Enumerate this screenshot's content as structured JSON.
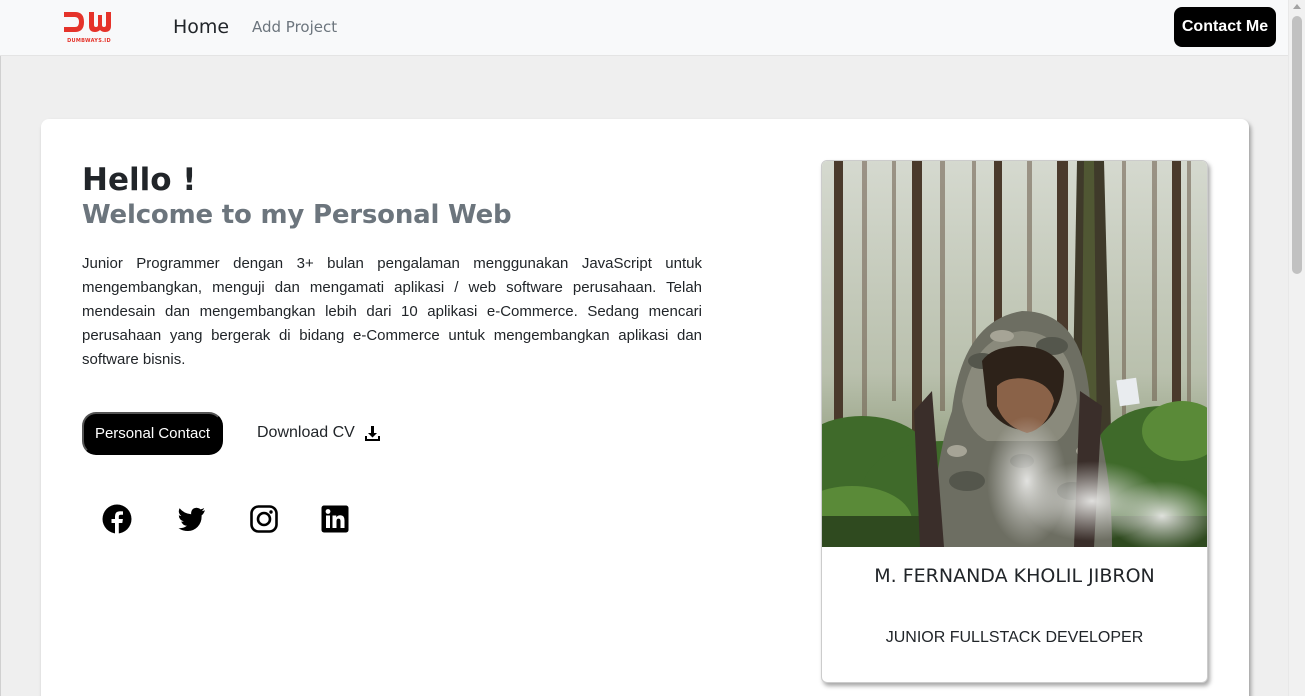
{
  "navbar": {
    "logo_text": "DUMBWAYS.ID",
    "home_label": "Home",
    "add_project_label": "Add Project",
    "contact_label": "Contact Me"
  },
  "hero": {
    "hello": "Hello !",
    "welcome": "Welcome to my Personal Web",
    "description": "Junior Programmer dengan 3+ bulan pengalaman menggunakan JavaScript untuk mengembangkan, menguji dan mengamati aplikasi / web software perusahaan. Telah mendesain dan mengembangkan lebih dari 10 aplikasi e-Commerce. Sedang mencari perusahaan yang bergerak di bidang e-Commerce untuk mengembangkan aplikasi dan software bisnis.",
    "personal_contact_label": "Personal Contact",
    "download_cv_label": "Download CV"
  },
  "social": {
    "icons": [
      "facebook-icon",
      "twitter-icon",
      "instagram-icon",
      "linkedin-icon"
    ]
  },
  "profile": {
    "name": "M. FERNANDA KHOLIL JIBRON",
    "role": "JUNIOR FULLSTACK DEVELOPER"
  },
  "colors": {
    "brand_red": "#e5332a",
    "button_black": "#000000",
    "muted_text": "#6c757d",
    "page_bg": "#efefef"
  }
}
